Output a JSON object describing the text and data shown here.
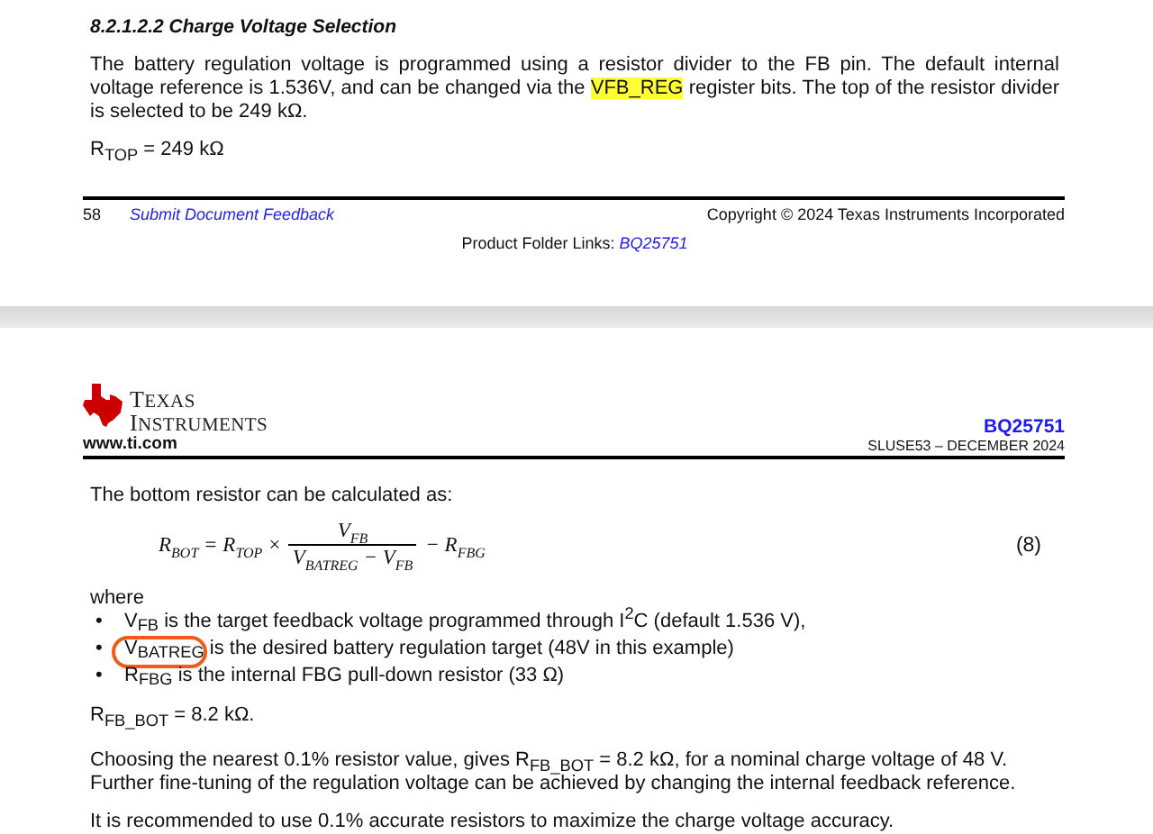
{
  "page_1": {
    "heading": "8.2.1.2.2 Charge Voltage Selection",
    "paragraph": [
      {
        "text": "The battery regulation voltage is programmed using a resistor divider to the FB pin. The default internal voltage reference is 1.536V, and can be changed via the ",
        "highlighted": false
      },
      {
        "text": "VFB_REG",
        "highlighted": true
      },
      {
        "text": " register bits. The top of the resistor divider is selected to be 249 kΩ.",
        "highlighted": false
      }
    ],
    "formula": "R$_{TOP}$ = 249 kΩ",
    "footer": {
      "page_number": "58",
      "feedback_link": "Submit Document Feedback",
      "copyright": "Copyright © 2024 Texas Instruments Incorporated",
      "product_links_label": "Product Folder Links:",
      "product_link": "BQ25751"
    }
  },
  "page_2": {
    "header": {
      "logo_line_1": "TEXAS",
      "logo_line_2": "INSTRUMENTS",
      "website": "www.ti.com",
      "part_number": "BQ25751",
      "document": "SLUSE53 – DECEMBER 2024"
    },
    "intro": "The bottom resistor can be calculated as:",
    "equation": {
      "lhs": "R$_{BOT}$ = R$_{TOP}$ ×",
      "numerator": "V$_{FB}$",
      "denominator": "V$_{BATREG}$ − V$_{FB}$",
      "tail": "− R$_{FBG}$",
      "number": "(8)"
    },
    "where": "where",
    "bullets": [
      {
        "marker": "•",
        "text": "V$_{FB}$ is the target feedback voltage programmed through I$^{2}$C (default 1.536 V),",
        "circled": false
      },
      {
        "marker": "•",
        "text": "V$_{BATREG}$ is the desired battery regulation target (48V in this example)",
        "circled": true
      },
      {
        "marker": "•",
        "text": "R$_{FBG}$ is the internal FBG pull-down resistor (33 Ω)",
        "circled": false
      }
    ],
    "result": "R$_{FB_BOT}$ = 8.2 kΩ.",
    "paragraphs": [
      "Choosing the nearest 0.1% resistor value, gives R$_{FB_BOT}$ = 8.2 kΩ, for a nominal charge voltage of 48 V. Further fine-tuning of the regulation voltage can be achieved by changing the internal feedback reference.",
      "It is recommended to use 0.1% accurate resistors to maximize the charge voltage accuracy."
    ]
  }
}
